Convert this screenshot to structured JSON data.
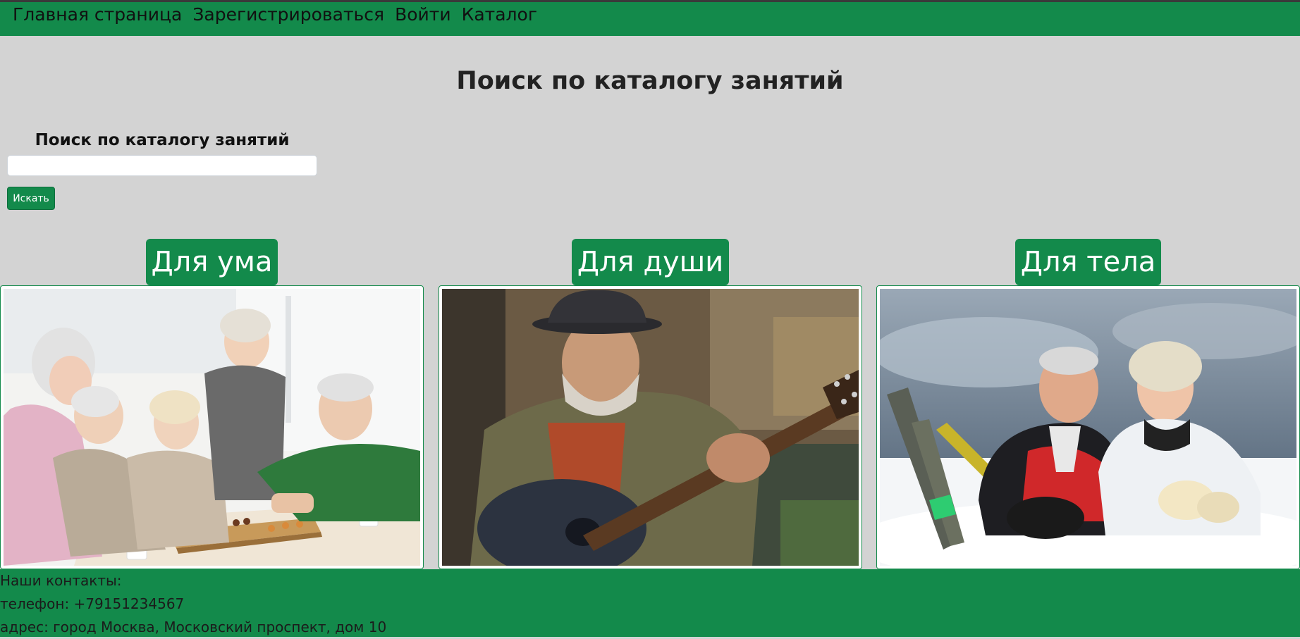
{
  "nav": {
    "home": "Главная страница",
    "register": "Зарегистрироваться",
    "login": "Войти",
    "catalog": "Каталог"
  },
  "page": {
    "title": "Поиск по каталогу занятий"
  },
  "search": {
    "label": "Поиск по каталогу занятий",
    "value": "",
    "placeholder": "",
    "button": "Искать"
  },
  "categories": [
    {
      "title": "Для ума",
      "image": "seniors-playing-chess-photo"
    },
    {
      "title": "Для души",
      "image": "man-playing-guitar-photo"
    },
    {
      "title": "Для тела",
      "image": "seniors-in-snow-skiing-photo"
    }
  ],
  "footer": {
    "heading": "Наши контакты:",
    "phone": "телефон: +79151234567",
    "address": "адрес: город Москва, Московский проспект, дом 10"
  },
  "colors": {
    "brand_green": "#138a4b",
    "page_background": "#d3d3d3"
  }
}
